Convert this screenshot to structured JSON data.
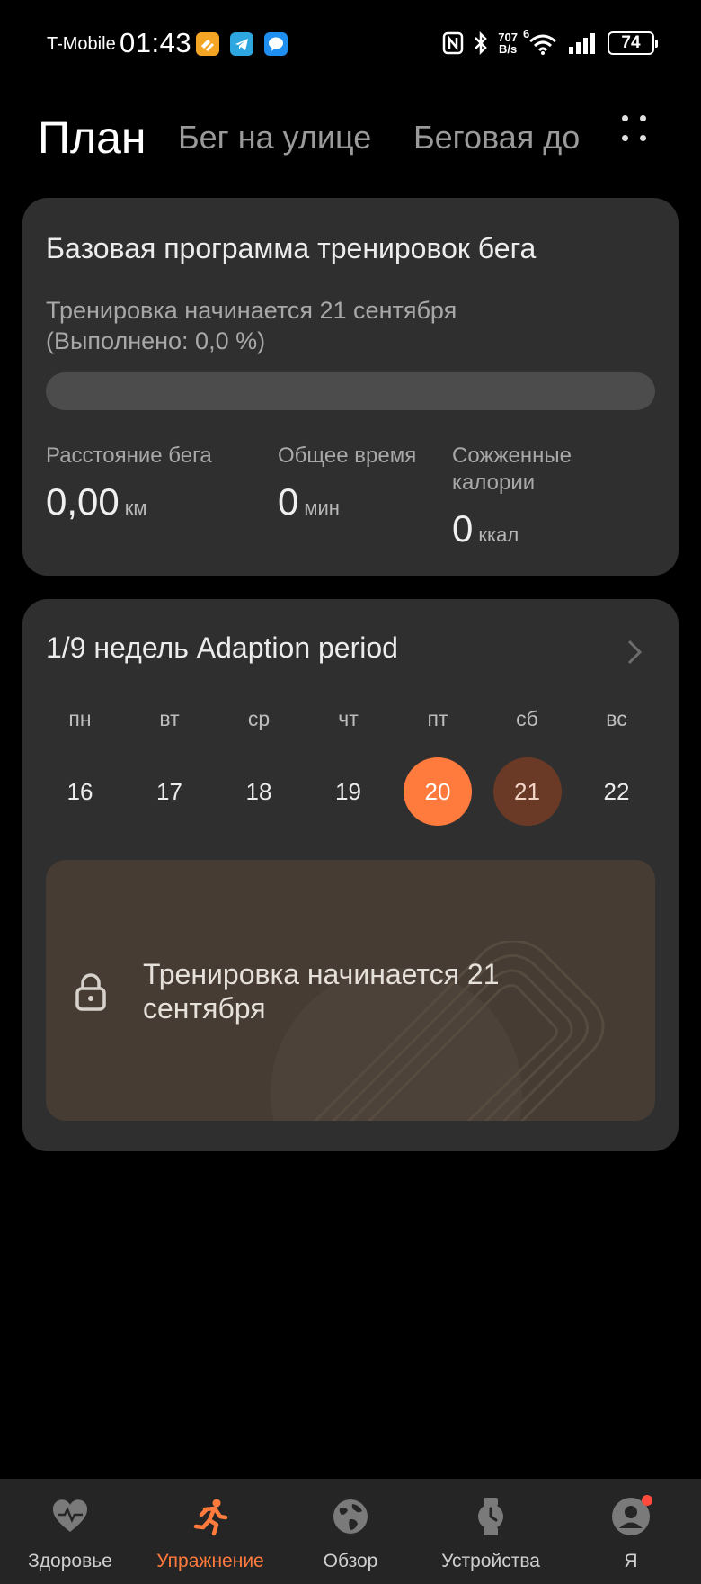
{
  "status_bar": {
    "carrier": "T-Mobile",
    "time": "01:43",
    "net_speed_value": "707",
    "net_speed_unit": "B/s",
    "wifi_badge": "6",
    "battery": "74",
    "icons": [
      "honey-app-icon",
      "telegram-icon",
      "messages-icon",
      "nfc-icon",
      "bluetooth-icon",
      "wifi-icon",
      "signal-icon",
      "battery-icon"
    ]
  },
  "tabs": [
    {
      "label": "План",
      "active": true
    },
    {
      "label": "Бег на улице",
      "active": false
    },
    {
      "label": "Беговая до",
      "active": false
    }
  ],
  "plan_card": {
    "title": "Базовая программа тренировок бега",
    "subtitle": "Тренировка начинается 21 сентября (Выполнено: 0,0 %)",
    "progress_percent": 0,
    "stats": [
      {
        "label": "Расстояние бега",
        "value": "0,00",
        "unit": "км"
      },
      {
        "label": "Общее время",
        "value": "0",
        "unit": "мин"
      },
      {
        "label": "Сожженные калории",
        "value": "0",
        "unit": "ккал"
      }
    ]
  },
  "week_card": {
    "title": "1/9 недель Adaption period",
    "days": [
      {
        "name": "пн",
        "num": "16",
        "state": "normal"
      },
      {
        "name": "вт",
        "num": "17",
        "state": "normal"
      },
      {
        "name": "ср",
        "num": "18",
        "state": "normal"
      },
      {
        "name": "чт",
        "num": "19",
        "state": "normal"
      },
      {
        "name": "пт",
        "num": "20",
        "state": "today"
      },
      {
        "name": "сб",
        "num": "21",
        "state": "start"
      },
      {
        "name": "вс",
        "num": "22",
        "state": "normal"
      }
    ],
    "lock_text": "Тренировка начинается 21 сентября"
  },
  "bottom_nav": [
    {
      "label": "Здоровье",
      "icon": "heart-pulse-icon",
      "active": false
    },
    {
      "label": "Упражнение",
      "icon": "running-person-icon",
      "active": true
    },
    {
      "label": "Обзор",
      "icon": "globe-icon",
      "active": false
    },
    {
      "label": "Устройства",
      "icon": "watch-icon",
      "active": false
    },
    {
      "label": "Я",
      "icon": "profile-icon",
      "active": false
    }
  ],
  "colors": {
    "accent": "#ff7a3d",
    "start_day": "#6b3a26",
    "card_bg": "#2f2f2f",
    "notification_dot": "#ff4a3d"
  }
}
